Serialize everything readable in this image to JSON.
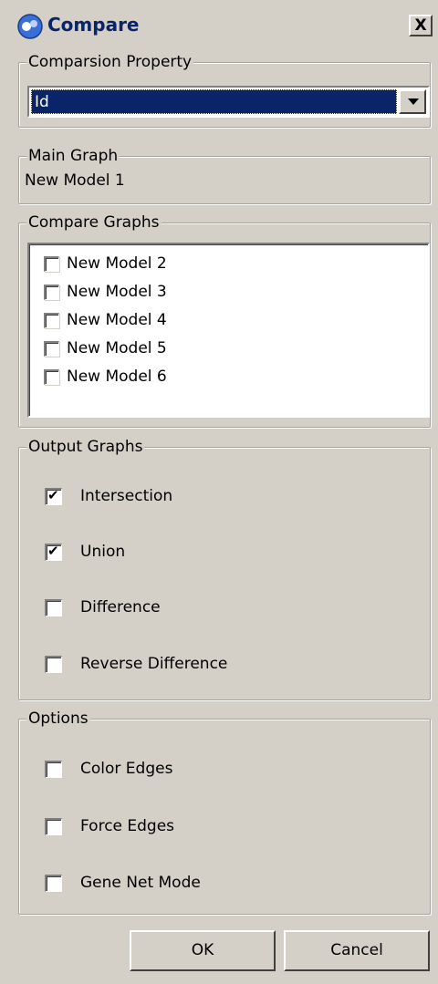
{
  "window": {
    "title": "Compare",
    "close_label": "X"
  },
  "comparison_property": {
    "legend": "Comparsion Property",
    "selected": "Id"
  },
  "main_graph": {
    "legend": "Main Graph",
    "value": "New Model 1"
  },
  "compare_graphs": {
    "legend": "Compare Graphs",
    "items": [
      {
        "label": "New Model 2",
        "checked": false
      },
      {
        "label": "New Model 3",
        "checked": false
      },
      {
        "label": "New Model 4",
        "checked": false
      },
      {
        "label": "New Model 5",
        "checked": false
      },
      {
        "label": "New Model 6",
        "checked": false
      }
    ]
  },
  "output_graphs": {
    "legend": "Output Graphs",
    "items": [
      {
        "label": "Intersection",
        "checked": true
      },
      {
        "label": "Union",
        "checked": true
      },
      {
        "label": "Difference",
        "checked": false
      },
      {
        "label": "Reverse Difference",
        "checked": false
      }
    ]
  },
  "options": {
    "legend": "Options",
    "items": [
      {
        "label": "Color Edges",
        "checked": false
      },
      {
        "label": "Force Edges",
        "checked": false
      },
      {
        "label": "Gene Net Mode",
        "checked": false
      }
    ]
  },
  "buttons": {
    "ok": "OK",
    "cancel": "Cancel"
  },
  "colors": {
    "face": "#d4d0c8",
    "selection": "#0a246a"
  }
}
